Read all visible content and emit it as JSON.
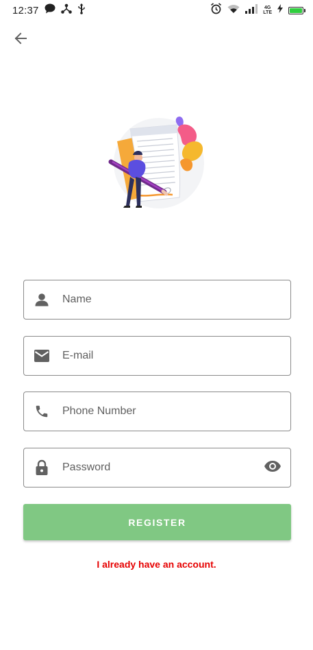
{
  "status_bar": {
    "time": "12:37",
    "network_label_top": "4G",
    "network_label_bottom": "LTE",
    "battery_level": 1.0,
    "icons": [
      "chat-icon",
      "usb-share-icon",
      "usb-icon",
      "alarm-icon",
      "wifi-icon",
      "cellular-signal-icon",
      "charging-icon",
      "battery-icon"
    ]
  },
  "navigation": {
    "back_icon": "arrow-back-icon"
  },
  "illustration": {
    "subject": "person-with-pen-and-document-illustration"
  },
  "form": {
    "name": {
      "placeholder": "Name",
      "value": "",
      "icon": "person-icon"
    },
    "email": {
      "placeholder": "E-mail",
      "value": "",
      "icon": "mail-icon"
    },
    "phone": {
      "placeholder": "Phone Number",
      "value": "",
      "icon": "phone-icon"
    },
    "password": {
      "placeholder": "Password",
      "value": "",
      "icon": "lock-icon",
      "toggle_icon": "eye-icon"
    }
  },
  "register_label": "REGISTER",
  "login_link": "I already have an account.",
  "colors": {
    "accent_button": "#80c883",
    "link": "#e60000",
    "field_border": "#8a8a8a",
    "icon": "#616161"
  }
}
